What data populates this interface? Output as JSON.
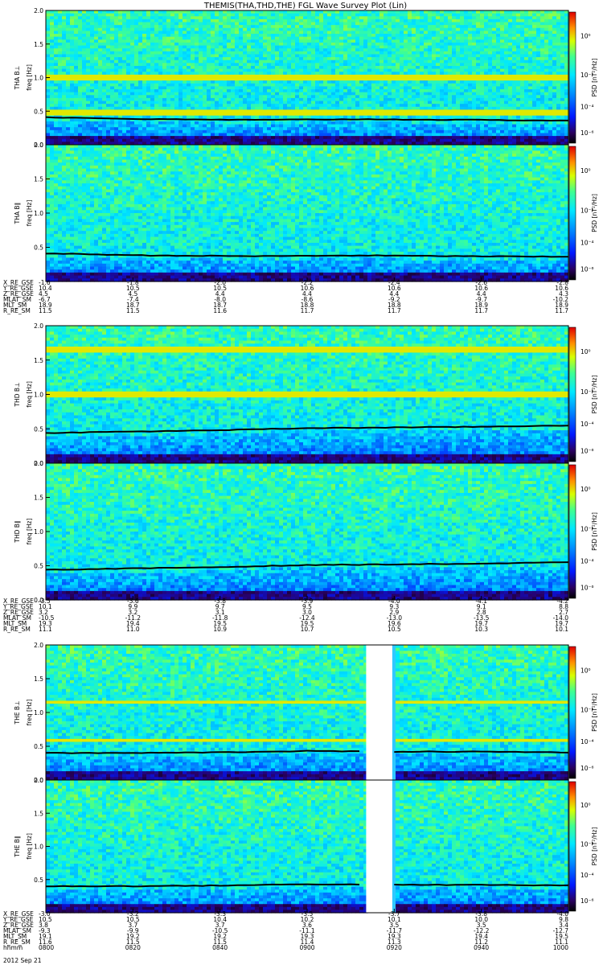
{
  "title": "THEMIS(THA,THD,THE) FGL Wave Survey Plot (Lin)",
  "colorbar": {
    "label": "PSD [nT²/Hz]",
    "ticks": [
      "10⁰",
      "10⁻¹",
      "10⁻⁴",
      "10⁻⁶"
    ]
  },
  "footer": {
    "time_label": "hhmm",
    "date_label": "2012 Sep 21"
  },
  "chart_data": [
    {
      "type": "heatmap",
      "panels": [
        {
          "ylabel": "THA B⊥",
          "sublabel": "freq [Hz]",
          "ylim": [
            0,
            2.0
          ],
          "yticks": [
            "0.0",
            "0.5",
            "1.0",
            "1.5",
            "2.0"
          ]
        },
        {
          "ylabel": "THA B∥",
          "sublabel": "freq [Hz]",
          "ylim": [
            0,
            2.0
          ],
          "yticks": [
            "0.5",
            "1.0",
            "1.5",
            "2.0"
          ]
        }
      ],
      "line_freq": [
        0.41,
        0.38,
        0.37,
        0.38,
        0.37,
        0.36
      ],
      "bright_lines": [
        1.0,
        0.48
      ],
      "ephemeris": {
        "labels": [
          "X_RE_GSE",
          "Y_RE_GSE",
          "Z_RE_GSE",
          "MLAT_SM",
          "MLT_SM",
          "R_RE_SM"
        ],
        "columns": [
          [
            "-1.6",
            "10.4",
            "4.5",
            "-6.7",
            "18.9",
            "11.5"
          ],
          [
            "-1.8",
            "10.5",
            "4.5",
            "-7.4",
            "18.7",
            "11.5"
          ],
          [
            "-2.0",
            "10.5",
            "4.4",
            "-8.0",
            "18.7",
            "11.6"
          ],
          [
            "-2.2",
            "10.6",
            "4.4",
            "-8.6",
            "18.8",
            "11.7"
          ],
          [
            "-2.4",
            "10.6",
            "4.4",
            "-9.2",
            "18.8",
            "11.7"
          ],
          [
            "-2.6",
            "10.6",
            "4.4",
            "-9.7",
            "18.9",
            "11.7"
          ],
          [
            "-2.8",
            "10.6",
            "4.3",
            "-10.2",
            "18.9",
            "11.7"
          ]
        ]
      }
    },
    {
      "type": "heatmap",
      "panels": [
        {
          "ylabel": "THD B⊥",
          "sublabel": "freq [Hz]",
          "ylim": [
            0,
            2.0
          ],
          "yticks": [
            "0.0",
            "0.5",
            "1.0",
            "1.5",
            "2.0"
          ]
        },
        {
          "ylabel": "THD B∥",
          "sublabel": "freq [Hz]",
          "ylim": [
            0,
            2.0
          ],
          "yticks": [
            "0.0",
            "0.5",
            "1.0",
            "1.5",
            "2.0"
          ]
        }
      ],
      "line_freq": [
        0.44,
        0.46,
        0.48,
        0.51,
        0.52,
        0.53,
        0.55
      ],
      "bright_lines": [
        1.65,
        1.0
      ],
      "ephemeris": {
        "labels": [
          "X_RE_GSE",
          "Y_RE_GSE",
          "Z_RE_GSE",
          "MLAT_SM",
          "MLT_SM",
          "R_RE_SM"
        ],
        "columns": [
          [
            "-3.5",
            "10.1",
            "3.2",
            "-10.5",
            "19.3",
            "11.1"
          ],
          [
            "-3.6",
            "9.9",
            "3.2",
            "-11.2",
            "19.4",
            "11.0"
          ],
          [
            "-3.8",
            "9.7",
            "3.1",
            "-11.8",
            "19.5",
            "10.9"
          ],
          [
            "-3.9",
            "9.5",
            "3.0",
            "-12.4",
            "19.5",
            "10.7"
          ],
          [
            "-4.0",
            "9.3",
            "2.9",
            "-13.0",
            "19.6",
            "10.5"
          ],
          [
            "-4.1",
            "9.1",
            "2.8",
            "-13.5",
            "19.7",
            "10.3"
          ],
          [
            "-4.2",
            "8.8",
            "2.7",
            "-14.0",
            "19.7",
            "10.1"
          ]
        ]
      }
    },
    {
      "type": "heatmap",
      "panels": [
        {
          "ylabel": "THE B⊥",
          "sublabel": "freq [Hz]",
          "ylim": [
            0,
            2.0
          ],
          "yticks": [
            "0.0",
            "0.5",
            "1.0",
            "1.5",
            "2.0"
          ]
        },
        {
          "ylabel": "THE B∥",
          "sublabel": "freq [Hz]",
          "ylim": [
            0,
            2.0
          ],
          "yticks": [
            "0.5",
            "1.0",
            "1.5",
            "2.0"
          ]
        }
      ],
      "line_freq": [
        0.4,
        0.4,
        0.41,
        0.43,
        0.42,
        0.42,
        0.41
      ],
      "bright_lines": [
        1.15,
        0.58
      ],
      "gap_time": [
        "0914",
        "0921"
      ],
      "ephemeris": {
        "labels": [
          "X_RE_GSE",
          "Y_RE_GSE",
          "Z_RE_GSE",
          "MLAT_SM",
          "MLT_SM",
          "R_RE_SM",
          "hhmm"
        ],
        "columns": [
          [
            "-3.0",
            "10.5",
            "3.8",
            "-9.3",
            "19.1",
            "11.6",
            "0800"
          ],
          [
            "-3.2",
            "10.5",
            "3.7",
            "-9.9",
            "19.2",
            "11.5",
            "0820"
          ],
          [
            "-3.3",
            "10.4",
            "3.7",
            "-10.5",
            "19.2",
            "11.5",
            "0840"
          ],
          [
            "-3.5",
            "10.2",
            "3.6",
            "-11.1",
            "19.3",
            "11.4",
            "0900"
          ],
          [
            "-3.7",
            "10.1",
            "3.5",
            "-11.7",
            "19.3",
            "11.3",
            "0920"
          ],
          [
            "-3.8",
            "10.0",
            "3.5",
            "-12.2",
            "19.4",
            "11.2",
            "0940"
          ],
          [
            "-4.0",
            "9.8",
            "3.4",
            "-12.7",
            "19.5",
            "11.1",
            "1000"
          ]
        ]
      }
    }
  ]
}
